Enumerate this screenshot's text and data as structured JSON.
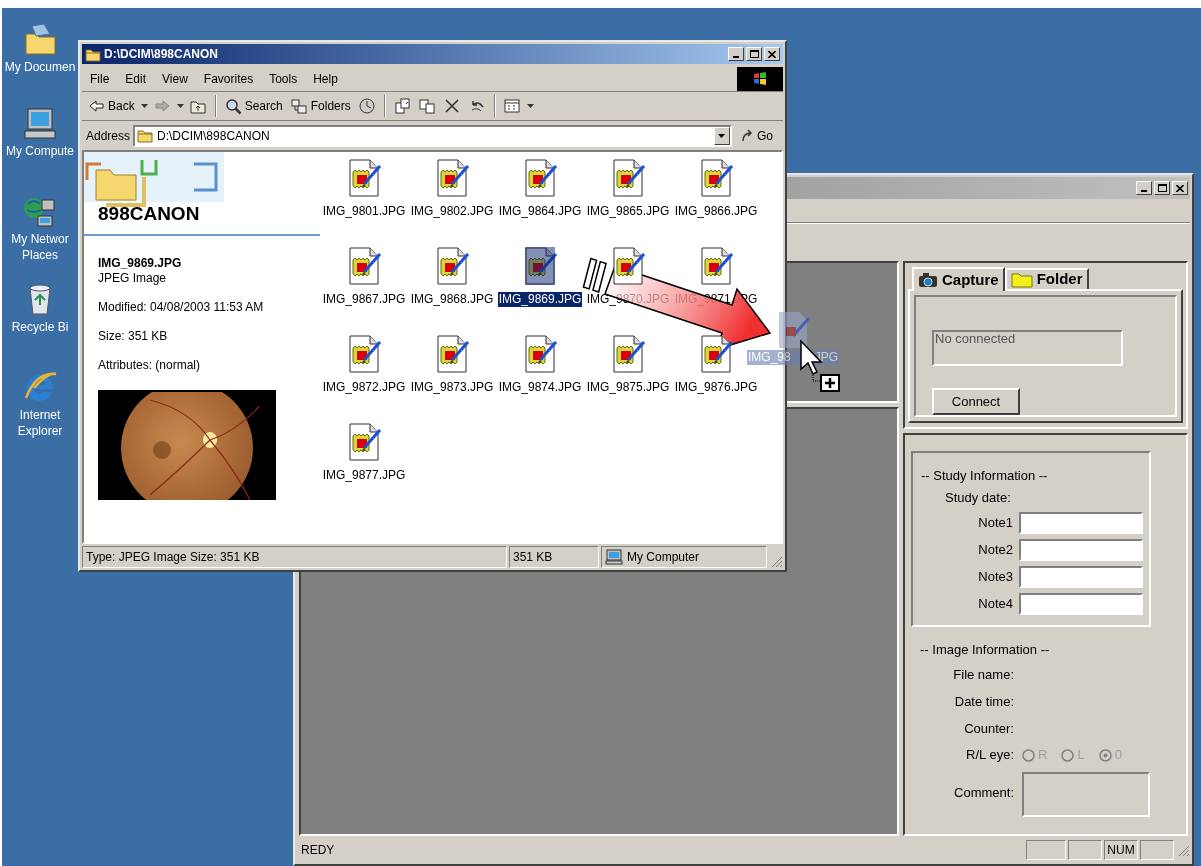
{
  "desktop_icons": [
    {
      "kind": "documents",
      "lines": [
        "My Documen"
      ]
    },
    {
      "kind": "computer",
      "lines": [
        "My Compute"
      ]
    },
    {
      "kind": "network",
      "lines": [
        "My Networ",
        "Places"
      ]
    },
    {
      "kind": "recycle",
      "lines": [
        "Recycle Bi"
      ]
    },
    {
      "kind": "browser",
      "lines": [
        "Internet",
        "Explorer"
      ]
    }
  ],
  "explorer": {
    "title": "D:\\DCIM\\898CANON",
    "menu": [
      "File",
      "Edit",
      "View",
      "Favorites",
      "Tools",
      "Help"
    ],
    "toolbar": [
      {
        "kind": "back",
        "label": "Back"
      },
      {
        "kind": "forward"
      },
      {
        "kind": "up"
      },
      {
        "kind": "search",
        "label": "Search"
      },
      {
        "kind": "folders",
        "label": "Folders"
      },
      {
        "kind": "history"
      },
      {
        "kind": "move"
      },
      {
        "kind": "copy"
      },
      {
        "kind": "delete"
      },
      {
        "kind": "undo"
      },
      {
        "kind": "views"
      }
    ],
    "address": {
      "label": "Address",
      "value": "D:\\DCIM\\898CANON",
      "go": "Go"
    },
    "folder_panel": {
      "name": "898CANON",
      "file": "IMG_9869.JPG",
      "type": "JPEG Image",
      "details": [
        "Modified: 04/08/2003 11:53 AM",
        "Size: 351 KB",
        "Attributes: (normal)"
      ],
      "preview": {
        "kind": "picture"
      }
    },
    "files": [
      {
        "name": "IMG_9801.JPG",
        "selected": false
      },
      {
        "name": "IMG_9802.JPG",
        "selected": false
      },
      {
        "name": "IMG_9864.JPG",
        "selected": false
      },
      {
        "name": "IMG_9865.JPG",
        "selected": false
      },
      {
        "name": "IMG_9866.JPG",
        "selected": false
      },
      {
        "name": "IMG_9867.JPG",
        "selected": false
      },
      {
        "name": "IMG_9868.JPG",
        "selected": false
      },
      {
        "name": "IMG_9869.JPG",
        "selected": true
      },
      {
        "name": "IMG_9870.JPG",
        "selected": false
      },
      {
        "name": "IMG_9871.JPG",
        "selected": false
      },
      {
        "name": "IMG_9872.JPG",
        "selected": false
      },
      {
        "name": "IMG_9873.JPG",
        "selected": false
      },
      {
        "name": "IMG_9874.JPG",
        "selected": false
      },
      {
        "name": "IMG_9875.JPG",
        "selected": false
      },
      {
        "name": "IMG_9876.JPG",
        "selected": false
      },
      {
        "name": "IMG_9877.JPG",
        "selected": false
      }
    ],
    "status_bar": [
      "Type: JPEG Image Size: 351 KB",
      "351 KB",
      "My Computer"
    ]
  },
  "drag": {
    "label_parts": [
      "IMG_98",
      "JPG"
    ]
  },
  "app": {
    "tabs": [
      {
        "label": "Capture",
        "kind": "camera",
        "selected": true
      },
      {
        "label": "Folder",
        "kind": "folder",
        "selected": false
      }
    ],
    "connection_status": "No connected",
    "connect_button": "Connect",
    "study": {
      "heading": "-- Study Information --",
      "date_label": "Study date:",
      "notes": [
        "Note1",
        "Note2",
        "Note3",
        "Note4"
      ]
    },
    "image_info": {
      "heading": "-- Image Information --",
      "fields": [
        "File name:",
        "Date time:",
        "Counter:"
      ],
      "eye_label": "R/L eye:",
      "eye_disabled": true,
      "eye_options": [
        {
          "label": "R",
          "selected": false
        },
        {
          "label": "L",
          "selected": false
        },
        {
          "label": "0",
          "selected": true
        }
      ],
      "comment_label": "Comment:"
    },
    "status": {
      "text": "REDY",
      "indicators": [
        "NUM"
      ]
    }
  }
}
